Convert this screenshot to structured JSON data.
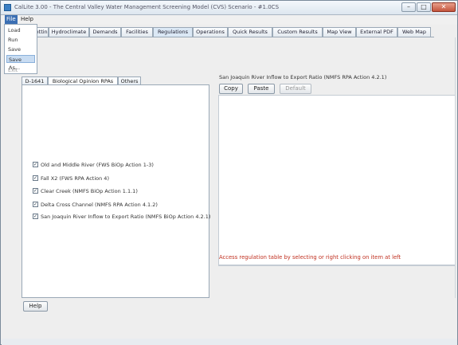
{
  "window": {
    "title": "CalLite 3.00 - The Central Valley Water Management Screening Model (CVS) Scenario - #1.0CS",
    "minimize_label": "–",
    "maximize_label": "□",
    "close_label": "✕"
  },
  "menubar": {
    "items": [
      {
        "label": "File"
      },
      {
        "label": "Help"
      }
    ]
  },
  "file_menu": {
    "items": [
      {
        "label": "Load",
        "state": "normal"
      },
      {
        "label": "Run",
        "state": "normal"
      },
      {
        "label": "Save",
        "state": "normal"
      },
      {
        "label": "Save As...",
        "state": "highlighted"
      },
      {
        "label": "Exit",
        "state": "disabled"
      }
    ]
  },
  "main_tabs": [
    {
      "label": "Run Settings"
    },
    {
      "label": "Hydroclimate"
    },
    {
      "label": "Demands"
    },
    {
      "label": "Facilities"
    },
    {
      "label": "Regulations",
      "selected": true
    },
    {
      "label": "Operations"
    },
    {
      "label": "Quick Results"
    },
    {
      "label": "Custom Results"
    },
    {
      "label": "Map View"
    },
    {
      "label": "External PDF"
    },
    {
      "label": "Web Map"
    }
  ],
  "sub_tabs": [
    {
      "label": "D-1641"
    },
    {
      "label": "Biological Opinion RPAs",
      "selected": true
    },
    {
      "label": "Others"
    }
  ],
  "rpa_checkboxes": [
    {
      "label": "Old and Middle River (FWS BiOp Action 1-3)",
      "checked": true
    },
    {
      "label": "Fall X2 (FWS RPA Action 4)",
      "checked": true
    },
    {
      "label": "Clear Creek (NMFS BiOp Action 1.1.1)",
      "checked": true
    },
    {
      "label": "Delta Cross Channel (NMFS RPA Action 4.1.2)",
      "checked": true
    },
    {
      "label": "San Joaquin River Inflow to Export Ratio (NMFS BiOp Action 4.2.1)",
      "checked": true
    }
  ],
  "right_panel": {
    "title": "San Joaquin River Inflow to Export Ratio (NMFS RPA Action 4.2.1)",
    "buttons": [
      {
        "label": "Copy",
        "enabled": true
      },
      {
        "label": "Paste",
        "enabled": true
      },
      {
        "label": "Default",
        "enabled": false
      }
    ],
    "hint": "Access regulation table by selecting or right clicking on item at left"
  },
  "footer": {
    "help_label": "Help"
  },
  "colors": {
    "menu_highlight": "#3b6fb3",
    "hint_red": "#c03020"
  }
}
